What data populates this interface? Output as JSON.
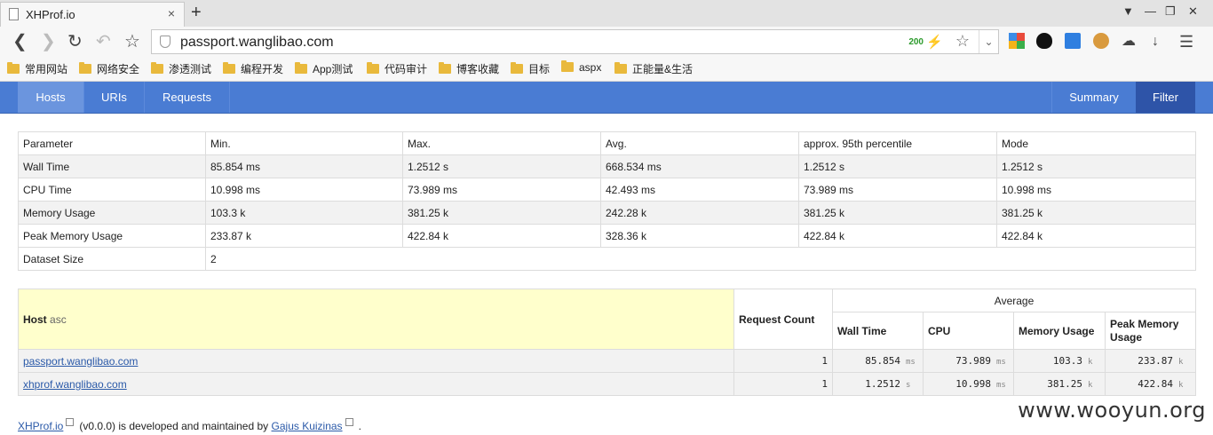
{
  "browser": {
    "tab_title": "XHProf.io",
    "tab_close": "×",
    "new_tab": "+",
    "url": "passport.wanglibao.com",
    "status_code": "200",
    "bookmarks": [
      "常用网站",
      "网络安全",
      "渗透测试",
      "编程开发",
      "App测试",
      "代码审计",
      "博客收藏",
      "目标",
      "aspx",
      "正能量&生活"
    ]
  },
  "nav": {
    "left": [
      "Hosts",
      "URIs",
      "Requests"
    ],
    "right": [
      "Summary",
      "Filter"
    ]
  },
  "stats": {
    "headers": [
      "Parameter",
      "Min.",
      "Max.",
      "Avg.",
      "approx. 95th percentile",
      "Mode"
    ],
    "rows": [
      [
        "Wall Time",
        "85.854 ms",
        "1.2512 s",
        "668.534 ms",
        "1.2512 s",
        "1.2512 s"
      ],
      [
        "CPU Time",
        "10.998 ms",
        "73.989 ms",
        "42.493 ms",
        "73.989 ms",
        "10.998 ms"
      ],
      [
        "Memory Usage",
        "103.3 k",
        "381.25 k",
        "242.28 k",
        "381.25 k",
        "381.25 k"
      ],
      [
        "Peak Memory Usage",
        "233.87 k",
        "422.84 k",
        "328.36 k",
        "422.84 k",
        "422.84 k"
      ]
    ],
    "dataset_label": "Dataset Size",
    "dataset_value": "2"
  },
  "hosts": {
    "host_header": "Host",
    "sort_label": "asc",
    "request_count_header": "Request Count",
    "average_header": "Average",
    "sub_headers": [
      "Wall Time",
      "CPU",
      "Memory Usage",
      "Peak Memory Usage"
    ],
    "rows": [
      {
        "host": "passport.wanglibao.com",
        "count": "1",
        "wall": "85.854",
        "wall_u": "ms",
        "cpu": "73.989",
        "cpu_u": "ms",
        "mem": "103.3",
        "mem_u": "k",
        "peak": "233.87",
        "peak_u": "k"
      },
      {
        "host": "xhprof.wanglibao.com",
        "count": "1",
        "wall": "1.2512",
        "wall_u": "s",
        "cpu": "10.998",
        "cpu_u": "ms",
        "mem": "381.25",
        "mem_u": "k",
        "peak": "422.84",
        "peak_u": "k"
      }
    ]
  },
  "footer": {
    "project_link": "XHProf.io",
    "middle_text": "(v0.0.0) is developed and maintained by",
    "author_link": "Gajus Kuizinas",
    "end": "."
  },
  "watermark": "www.wooyun.org"
}
